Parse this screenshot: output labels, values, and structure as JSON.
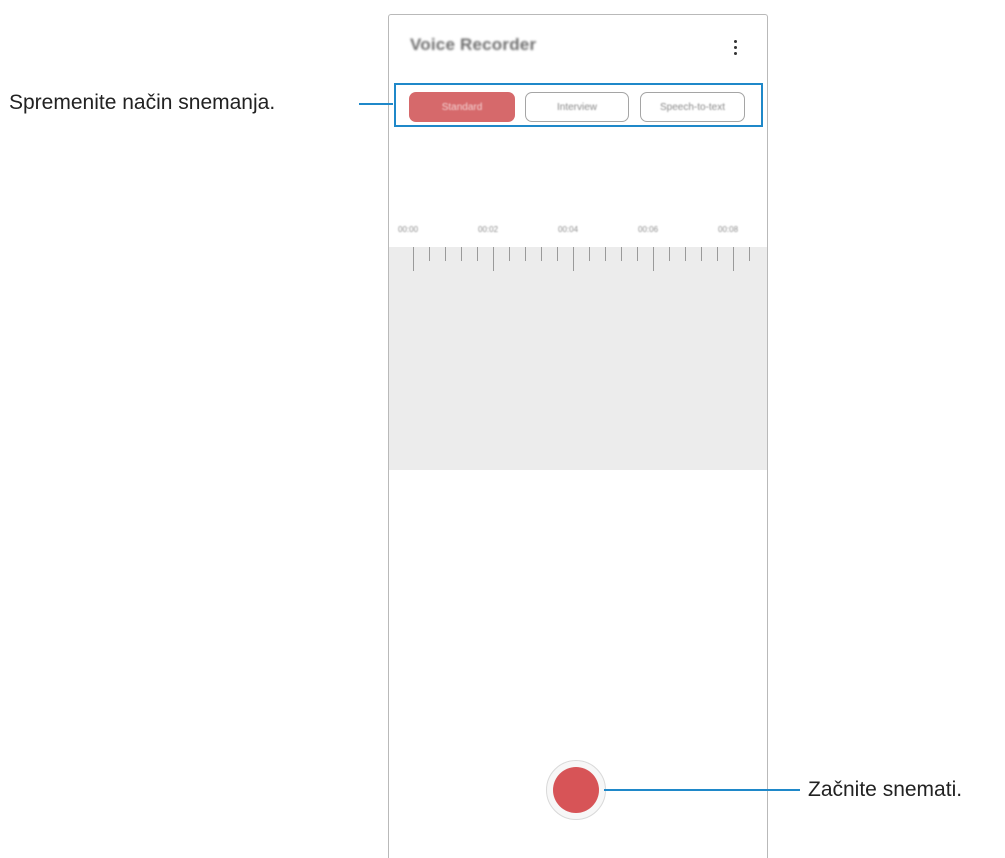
{
  "app": {
    "title": "Voice Recorder",
    "menu_icon": "more-vertical-icon"
  },
  "modes": [
    {
      "label": "Standard",
      "selected": true
    },
    {
      "label": "Interview",
      "selected": false
    },
    {
      "label": "Speech-to-text",
      "selected": false
    }
  ],
  "timeline": {
    "labels": [
      "00:00",
      "00:02",
      "00:04",
      "00:06",
      "00:08"
    ]
  },
  "record_button": {
    "icon": "record-icon"
  },
  "callouts": {
    "mode": "Spremenite način snemanja.",
    "record": "Začnite snemati."
  },
  "colors": {
    "accent_callout": "#1f88c9",
    "record_red": "#d75457",
    "selected_mode": "#d6696b"
  }
}
